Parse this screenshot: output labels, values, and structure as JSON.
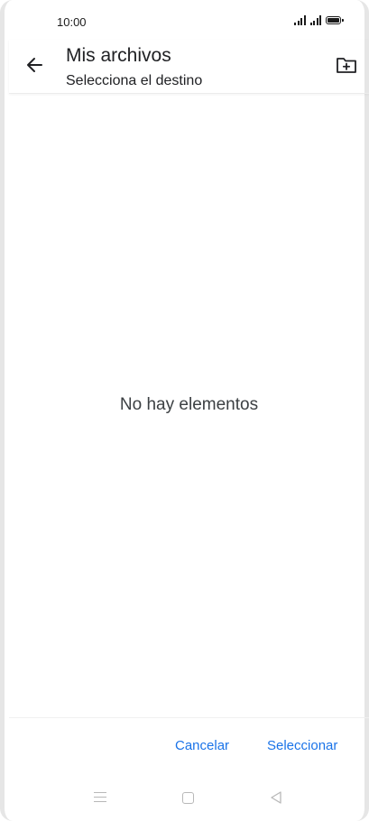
{
  "status_bar": {
    "time": "10:00"
  },
  "app_bar": {
    "title": "Mis archivos",
    "subtitle": "Selecciona el destino",
    "back_icon": "arrow-back-icon",
    "new_folder_icon": "create-new-folder-icon"
  },
  "content": {
    "empty_message": "No hay elementos"
  },
  "actions": {
    "cancel_label": "Cancelar",
    "select_label": "Seleccionar"
  },
  "colors": {
    "accent": "#1a73e8",
    "text": "#202124"
  }
}
